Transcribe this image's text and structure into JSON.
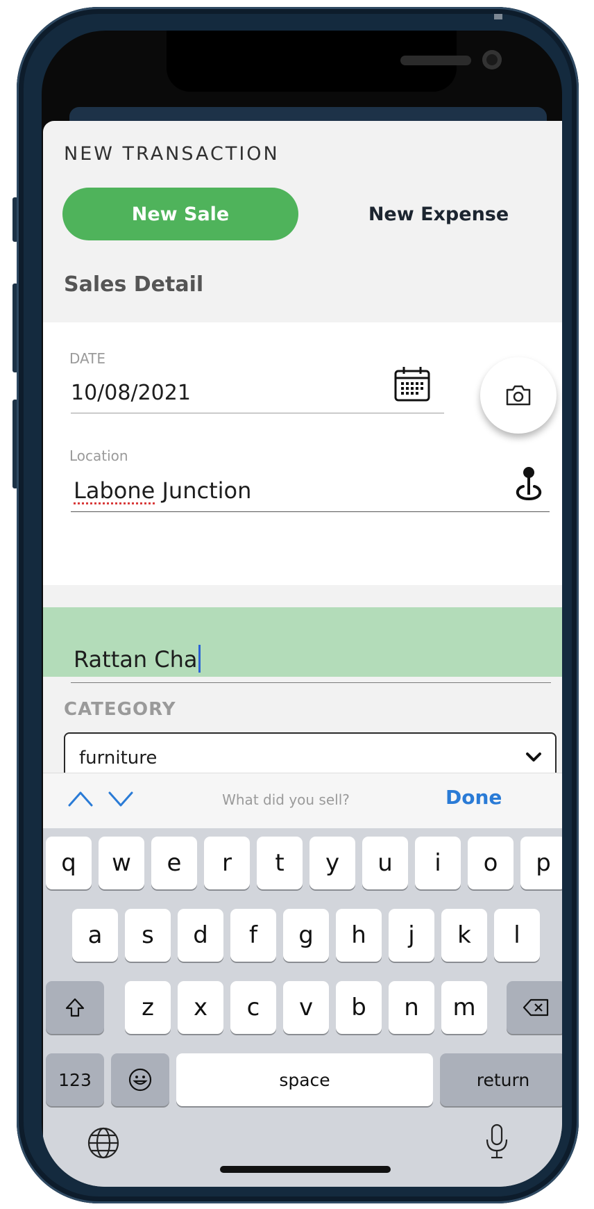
{
  "sheet": {
    "title": "NEW TRANSACTION",
    "tabs": [
      {
        "label": "New Sale",
        "active": true
      },
      {
        "label": "New Expense",
        "active": false
      }
    ],
    "section_label": "Sales Detail"
  },
  "form": {
    "date": {
      "caption": "DATE",
      "value": "10/08/2021"
    },
    "location": {
      "caption": "Location",
      "value_misspelled": "Labone",
      "value_rest": " Junction"
    },
    "product": {
      "value": "Rattan Cha"
    },
    "category": {
      "label": "CATEGORY",
      "value": "furniture"
    }
  },
  "accessory_bar": {
    "hint": "What did you sell?",
    "done_label": "Done"
  },
  "keyboard": {
    "row1": [
      "q",
      "w",
      "e",
      "r",
      "t",
      "y",
      "u",
      "i",
      "o",
      "p"
    ],
    "row2": [
      "a",
      "s",
      "d",
      "f",
      "g",
      "h",
      "j",
      "k",
      "l"
    ],
    "row3": [
      "z",
      "x",
      "c",
      "v",
      "b",
      "n",
      "m"
    ],
    "numbers_label": "123",
    "space_label": "space",
    "return_label": "return"
  },
  "colors": {
    "accent_green": "#4fb35b",
    "highlight_green": "#b3dcb9",
    "done_blue": "#2a7bd6"
  }
}
